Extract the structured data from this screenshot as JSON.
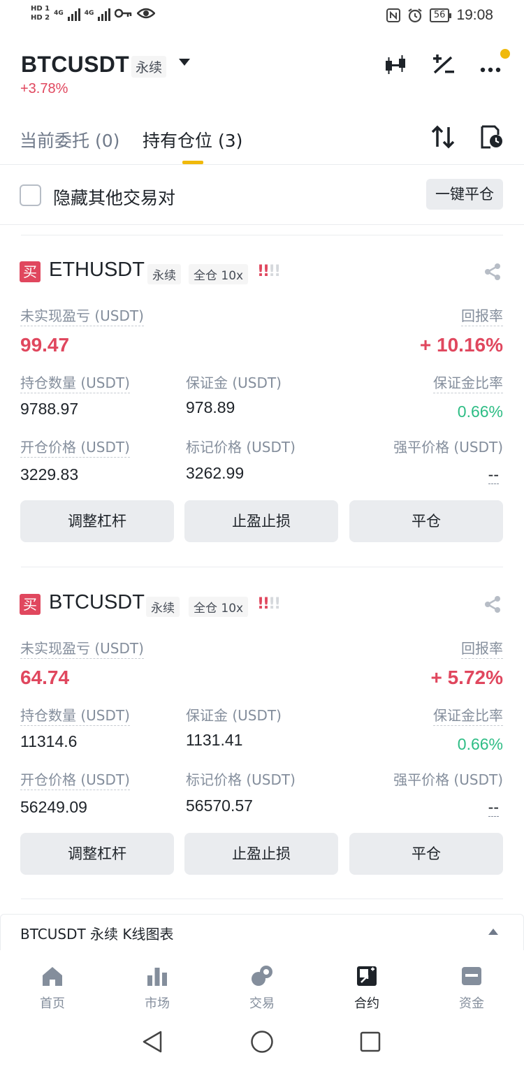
{
  "status_bar": {
    "hd1": "HD 1",
    "hd2": "HD 2",
    "net1": "4G",
    "net2": "4G",
    "battery": "56",
    "time": "19:08"
  },
  "header": {
    "symbol": "BTCUSDT",
    "perp_tag": "永续",
    "change": "+3.78%",
    "icons": [
      "candlestick-icon",
      "percent-icon",
      "more-icon"
    ]
  },
  "tabs": {
    "open_orders": "当前委托 (0)",
    "positions": "持有仓位 (3)"
  },
  "hide_row": {
    "label": "隐藏其他交易对",
    "close_all": "一键平仓"
  },
  "positions": [
    {
      "side": "买",
      "symbol": "ETHUSDT",
      "perp": "永续",
      "margin_mode": "全仓 10x",
      "risk_level": "2 of 4",
      "pnl_label": "未实现盈亏 (USDT)",
      "pnl": "99.47",
      "roe_label": "回报率",
      "roe": "+ 10.16%",
      "size_label": "持仓数量 (USDT)",
      "size": "9788.97",
      "margin_label": "保证金 (USDT)",
      "margin": "978.89",
      "margin_ratio_label": "保证金比率",
      "margin_ratio": "0.66%",
      "entry_label": "开仓价格 (USDT)",
      "entry": "3229.83",
      "mark_label": "标记价格 (USDT)",
      "mark": "3262.99",
      "liq_label": "强平价格 (USDT)",
      "liq": "--",
      "btn_leverage": "调整杠杆",
      "btn_tpsl": "止盈止损",
      "btn_close": "平仓"
    },
    {
      "side": "买",
      "symbol": "BTCUSDT",
      "perp": "永续",
      "margin_mode": "全仓 10x",
      "risk_level": "2 of 4",
      "pnl_label": "未实现盈亏 (USDT)",
      "pnl": "64.74",
      "roe_label": "回报率",
      "roe": "+ 5.72%",
      "size_label": "持仓数量 (USDT)",
      "size": "11314.6",
      "margin_label": "保证金 (USDT)",
      "margin": "1131.41",
      "margin_ratio_label": "保证金比率",
      "margin_ratio": "0.66%",
      "entry_label": "开仓价格 (USDT)",
      "entry": "56249.09",
      "mark_label": "标记价格 (USDT)",
      "mark": "56570.57",
      "liq_label": "强平价格 (USDT)",
      "liq": "--",
      "btn_leverage": "调整杠杆",
      "btn_tpsl": "止盈止损",
      "btn_close": "平仓"
    }
  ],
  "kline": {
    "label": "BTCUSDT 永续  K线图表"
  },
  "bottom_nav": [
    {
      "label": "首页",
      "icon": "home-icon"
    },
    {
      "label": "市场",
      "icon": "market-icon"
    },
    {
      "label": "交易",
      "icon": "trade-icon"
    },
    {
      "label": "合约",
      "icon": "futures-icon",
      "active": true
    },
    {
      "label": "资金",
      "icon": "wallet-icon"
    }
  ],
  "colors": {
    "accent": "#f0b90b",
    "red": "#e0475e",
    "green": "#2ebd85",
    "muted": "#848e9c"
  }
}
